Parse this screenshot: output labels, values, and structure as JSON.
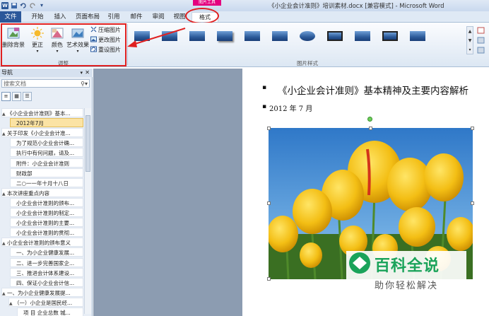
{
  "window": {
    "title": "《小企业会计准则》培训素材.docx [兼容模式] - Microsoft Word",
    "context_tab_title": "图片工具"
  },
  "quick_access": {
    "icons": [
      "word-logo-icon",
      "save-icon",
      "undo-icon",
      "redo-icon",
      "customize-icon"
    ],
    "logo_letter": "W"
  },
  "tabs": {
    "file": "文件",
    "items": [
      "开始",
      "插入",
      "页面布局",
      "引用",
      "邮件",
      "审阅",
      "视图"
    ],
    "active": "格式"
  },
  "ribbon": {
    "adjust_group": {
      "label": "调整",
      "remove_background": "删除背景",
      "corrections": "更正",
      "color": "颜色",
      "artistic_effects": "艺术效果",
      "compress": "压缩图片",
      "change_picture": "更改图片",
      "reset_picture": "重设图片"
    },
    "styles_group": {
      "label": "图片样式",
      "thumbnail_count": 11
    }
  },
  "nav_pane": {
    "title": "导航",
    "search_placeholder": "搜索文档",
    "tree": [
      {
        "text": "《小企业会计准则》基本...",
        "level": 0,
        "expand": "▲"
      },
      {
        "text": "2012年7月",
        "level": 1,
        "selected": true
      },
      {
        "text": "关于印发《小企业会计准...",
        "level": 0,
        "expand": "▲"
      },
      {
        "text": "为了规范小企业会计确...",
        "level": 1
      },
      {
        "text": "执行中有何问题，请及...",
        "level": 1
      },
      {
        "text": "附件：小企业会计准则",
        "level": 1
      },
      {
        "text": "财政部",
        "level": 1
      },
      {
        "text": "二○一一年十月十八日",
        "level": 1
      },
      {
        "text": "本次讲座重点内容",
        "level": 0,
        "expand": "▲"
      },
      {
        "text": "小企业会计准则的颁布...",
        "level": 1
      },
      {
        "text": "小企业会计准则的制定...",
        "level": 1
      },
      {
        "text": "小企业会计准则的主要...",
        "level": 1
      },
      {
        "text": "小企业会计准则的贯彻...",
        "level": 1
      },
      {
        "text": "小企业会计准则的颁布意义",
        "level": 0,
        "expand": "▲"
      },
      {
        "text": "一、为小企业健康发展...",
        "level": 1
      },
      {
        "text": "二、进一步完善国家企...",
        "level": 1
      },
      {
        "text": "三、推进会计体系建设...",
        "level": 1
      },
      {
        "text": "四、保证小企业会计信...",
        "level": 1
      },
      {
        "text": "一、为小企业健康发展提...",
        "level": 0,
        "expand": "▲"
      },
      {
        "text": "（一）小企业是国民经...",
        "level": 1,
        "expand": "▲"
      },
      {
        "text": "项 目 企业总数 城...",
        "level": 2
      }
    ]
  },
  "document": {
    "heading": "《小企业会计准则》基本精神及主要内容解析",
    "date": "2012 年 7 月"
  },
  "watermark": {
    "title": "百科全说",
    "subtitle": "助你轻松解决"
  }
}
